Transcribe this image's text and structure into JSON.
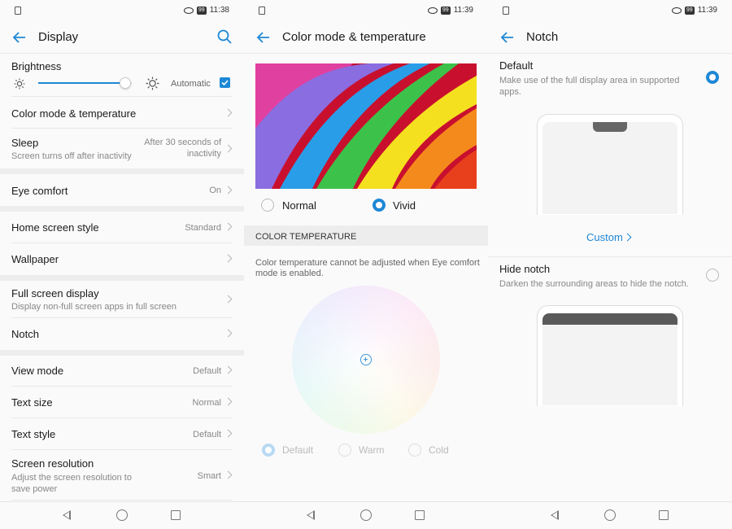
{
  "screens": [
    {
      "status_time": "11:38",
      "battery": "99",
      "title": "Display",
      "brightness": {
        "label": "Brightness",
        "automatic_label": "Automatic",
        "automatic_checked": true,
        "level": 0.93
      },
      "rows": {
        "color_mode": {
          "title": "Color mode & temperature"
        },
        "sleep": {
          "title": "Sleep",
          "subtitle": "Screen turns off after inactivity",
          "value": "After 30 seconds of inactivity"
        },
        "eye_comfort": {
          "title": "Eye comfort",
          "value": "On"
        },
        "home_style": {
          "title": "Home screen style",
          "value": "Standard"
        },
        "wallpaper": {
          "title": "Wallpaper"
        },
        "full_screen": {
          "title": "Full screen display",
          "subtitle": "Display non-full screen apps in full screen"
        },
        "notch": {
          "title": "Notch"
        },
        "view_mode": {
          "title": "View mode",
          "value": "Default"
        },
        "text_size": {
          "title": "Text size",
          "value": "Normal"
        },
        "text_style": {
          "title": "Text style",
          "value": "Default"
        },
        "resolution": {
          "title": "Screen resolution",
          "subtitle": "Adjust the screen resolution to save power",
          "value": "Smart"
        }
      }
    },
    {
      "status_time": "11:39",
      "battery": "99",
      "title": "Color mode & temperature",
      "modes": {
        "normal": "Normal",
        "vivid": "Vivid",
        "selected": "vivid"
      },
      "section_header": "COLOR TEMPERATURE",
      "note": "Color temperature cannot be adjusted when Eye comfort mode is enabled.",
      "temp_options": {
        "default": "Default",
        "warm": "Warm",
        "cold": "Cold",
        "selected": "default"
      }
    },
    {
      "status_time": "11:39",
      "battery": "99",
      "title": "Notch",
      "default_option": {
        "title": "Default",
        "subtitle": "Make use of the full display area in supported apps.",
        "selected": true
      },
      "custom_label": "Custom",
      "hide_option": {
        "title": "Hide notch",
        "subtitle": "Darken the surrounding areas to hide the notch.",
        "selected": false
      }
    }
  ],
  "colors": {
    "accent": "#1e88d6",
    "divider": "#e8e8e8",
    "section_bg": "#ededed"
  }
}
